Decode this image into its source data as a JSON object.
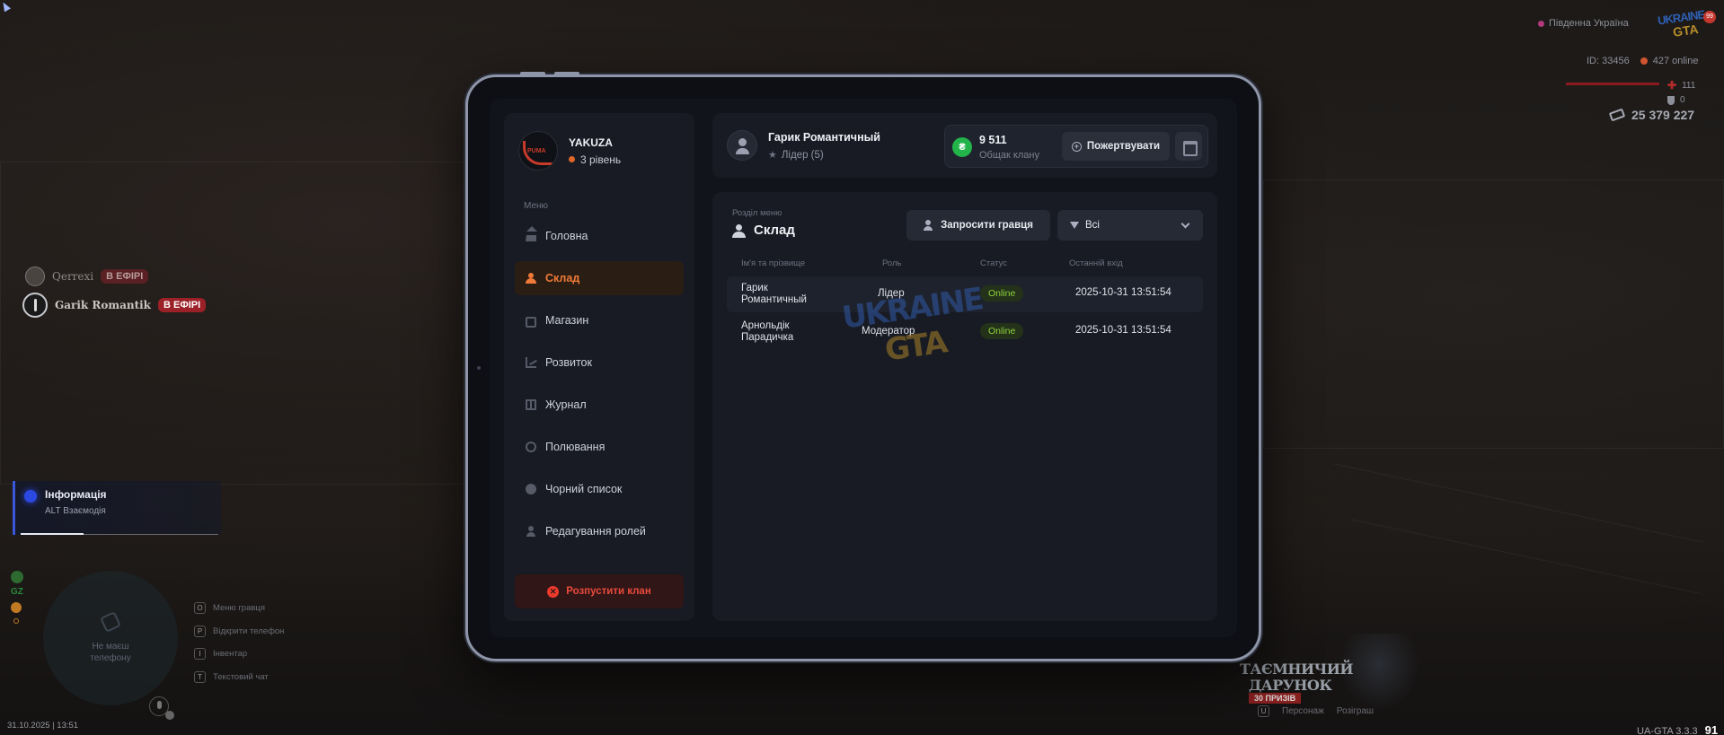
{
  "hud": {
    "location": "Південна Україна",
    "logo_line1": "UKRAINE",
    "logo_line2": "GTA",
    "logo_badge": "99",
    "player_id": "ID: 33456",
    "online": "427 online",
    "health": "111",
    "armor": "0",
    "money": "25 379 227"
  },
  "voice": [
    {
      "name": "Qerrexi",
      "badge": "В ЕФІРІ"
    },
    {
      "name": "Garik Romantik",
      "badge": "В ЕФІРІ"
    }
  ],
  "notification": {
    "title": "Інформація",
    "subtitle": "ALT Взаємодія"
  },
  "bottom_left": {
    "gz": "GZ",
    "minimap_text": "Не маєш телефону",
    "hints": [
      {
        "key": "O",
        "label": "Меню гравця"
      },
      {
        "key": "P",
        "label": "Відкрити телефон"
      },
      {
        "key": "I",
        "label": "Інвентар"
      },
      {
        "key": "T",
        "label": "Текстовий чат"
      }
    ],
    "datetime": "31.10.2025 | 13:51"
  },
  "promo": {
    "line1": "ТАЄМНИЧИЙ",
    "line2": "ДАРУНОК",
    "line3": "30 ПРИЗІВ",
    "footer_key": "U",
    "footer_a": "Персонаж",
    "footer_b": "Розіграш"
  },
  "version": {
    "label": "UA-GTA 3.3.3",
    "fps": "91"
  },
  "tablet": {
    "clan": {
      "name": "YAKUZA",
      "level": "3 рівень",
      "logo_text": "PUMA"
    },
    "menu_caption": "Меню",
    "menu": [
      {
        "label": "Головна",
        "icon": "home-icon"
      },
      {
        "label": "Склад",
        "icon": "people-icon"
      },
      {
        "label": "Магазин",
        "icon": "shop-icon"
      },
      {
        "label": "Розвиток",
        "icon": "chart-icon"
      },
      {
        "label": "Журнал",
        "icon": "book-icon"
      },
      {
        "label": "Полювання",
        "icon": "target-icon"
      },
      {
        "label": "Чорний список",
        "icon": "block-icon"
      },
      {
        "label": "Редагування ролей",
        "icon": "user-icon"
      }
    ],
    "active_menu": "Склад",
    "dissolve_label": "Розпустити клан",
    "user": {
      "name": "Гарик Романтичный",
      "role": "Лідер (5)"
    },
    "bank": {
      "coin": "₴",
      "amount": "9 511",
      "caption": "Общак клану",
      "donate_label": "Пожертвувати"
    },
    "section": {
      "caption": "Розділ меню",
      "title": "Склад"
    },
    "invite_label": "Запросити гравця",
    "filter": {
      "selected": "Всі"
    },
    "table": {
      "headers": [
        "Ім'я та прізвище",
        "Роль",
        "Статус",
        "Останній вхід"
      ],
      "rows": [
        {
          "name": "Гарик Романтичный",
          "role": "Лідер",
          "status": "Online",
          "last_login": "2025-10-31 13:51:54"
        },
        {
          "name": "Арнольдік Парадичка",
          "role": "Модератор",
          "status": "Online",
          "last_login": "2025-10-31 13:51:54"
        }
      ]
    },
    "watermark": {
      "line1": "UKRAINE",
      "line2": "GTA"
    },
    "colors": {
      "accent": "#f07a37",
      "online": "#8ed23c",
      "danger": "#ea4a3c",
      "coin": "#22b44a"
    }
  }
}
